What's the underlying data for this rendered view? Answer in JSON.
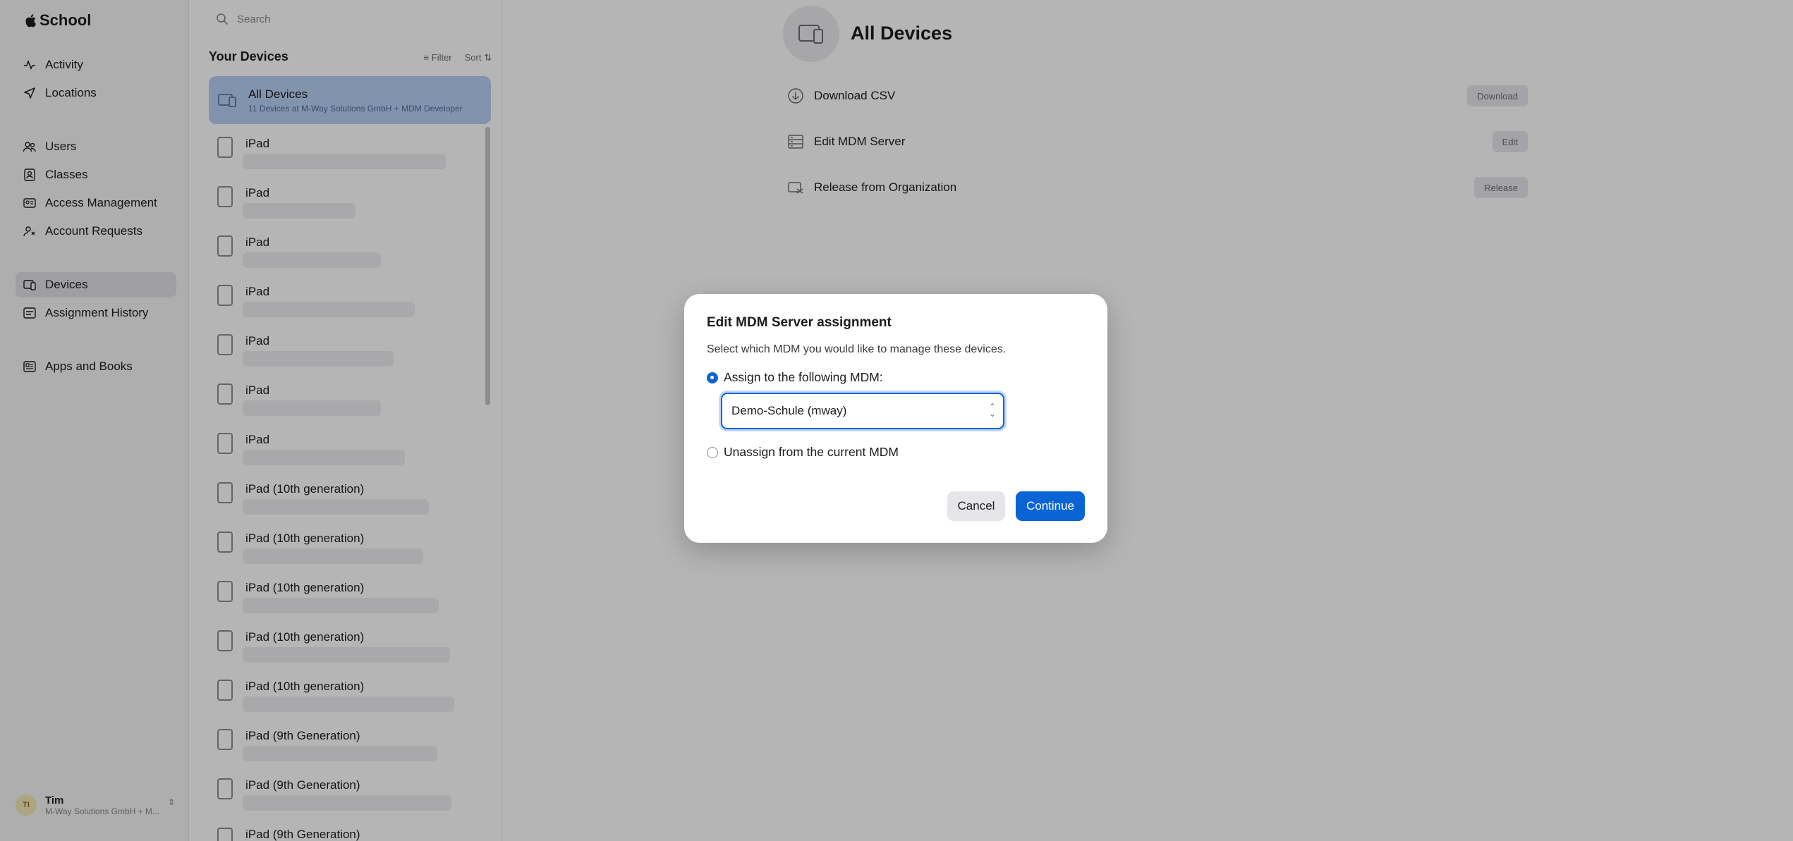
{
  "app": {
    "title": "School"
  },
  "sidebar": {
    "items": [
      {
        "label": "Activity",
        "icon": "activity-icon"
      },
      {
        "label": "Locations",
        "icon": "location-icon"
      },
      {
        "label": "Users",
        "icon": "users-icon"
      },
      {
        "label": "Classes",
        "icon": "classes-icon"
      },
      {
        "label": "Access Management",
        "icon": "access-icon"
      },
      {
        "label": "Account Requests",
        "icon": "account-requests-icon"
      },
      {
        "label": "Devices",
        "icon": "devices-icon",
        "active": true
      },
      {
        "label": "Assignment History",
        "icon": "history-icon"
      },
      {
        "label": "Apps and Books",
        "icon": "apps-icon"
      }
    ],
    "account": {
      "initials": "TI",
      "name": "Tim",
      "org": "M-Way Solutions GmbH + M..."
    }
  },
  "devices_list": {
    "search_placeholder": "Search",
    "title": "Your Devices",
    "filter_label": "Filter",
    "sort_label": "Sort",
    "all_devices": {
      "label": "All Devices",
      "subtitle": "11 Devices at M-Way Solutions GmbH + MDM Developer"
    },
    "items": [
      "iPad",
      "iPad",
      "iPad",
      "iPad",
      "iPad",
      "iPad",
      "iPad",
      "iPad (10th generation)",
      "iPad (10th generation)",
      "iPad (10th generation)",
      "iPad (10th generation)",
      "iPad (10th generation)",
      "iPad (9th Generation)",
      "iPad (9th Generation)",
      "iPad (9th Generation)"
    ]
  },
  "detail": {
    "title": "All Devices",
    "actions": [
      {
        "label": "Download CSV",
        "button": "Download",
        "icon": "download-icon"
      },
      {
        "label": "Edit MDM Server",
        "button": "Edit",
        "icon": "server-icon"
      },
      {
        "label": "Release from Organization",
        "button": "Release",
        "icon": "release-icon"
      }
    ]
  },
  "modal": {
    "title": "Edit MDM Server assignment",
    "description": "Select which MDM you would like to manage these devices.",
    "option_assign": "Assign to the following MDM:",
    "selected_mdm": "Demo-Schule (mway)",
    "option_unassign": "Unassign from the current MDM",
    "cancel_label": "Cancel",
    "continue_label": "Continue"
  },
  "colors": {
    "accent": "#0a64d6",
    "selection": "#b8d0f5",
    "overlay": "rgba(0,0,0,0.29)"
  }
}
